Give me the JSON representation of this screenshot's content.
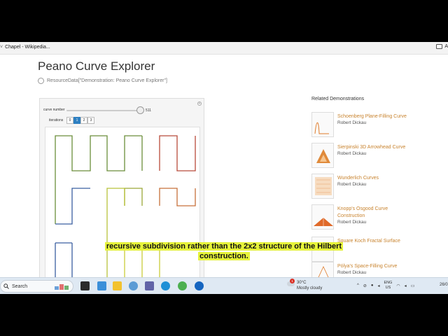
{
  "browser": {
    "bookmark_left": "Chapel - Wikipedia...",
    "bookmark_right": "A"
  },
  "page": {
    "title": "Peano Curve Explorer",
    "resource": "ResourceData[\"Demonstration: Peano Curve Explorer\"]"
  },
  "controls": {
    "curve_label": "curve number",
    "curve_value": "511",
    "curve_fraction": 0.95,
    "iterations_label": "iterations",
    "iterations": [
      "0",
      "1",
      "2",
      "3"
    ],
    "iterations_selected": "1"
  },
  "related": {
    "title": "Related Demonstrations",
    "items": [
      {
        "name": "Schoenberg Plane-Filling Curve",
        "author": "Robert Dickau"
      },
      {
        "name": "Sierpinski 3D Arrowhead Curve",
        "author": "Robert Dickau"
      },
      {
        "name": "Wunderlich Curves",
        "author": "Robert Dickau"
      },
      {
        "name": "Knopp's Osgood Curve Construction",
        "author": "Robert Dickau"
      },
      {
        "name": "Square Koch Fractal Surface",
        "author": ""
      },
      {
        "name": "Pólya's Space-Filling Curve",
        "author": "Robert Dickau"
      }
    ]
  },
  "caption": {
    "line1": "recursive subdivision rather than the 2x2 structure of the Hilbert",
    "line2": "construction."
  },
  "taskbar": {
    "search_placeholder": "Search",
    "weather_temp": "30°C",
    "weather_desc": "Mostly cloudy",
    "weather_badge": "1",
    "lang_top": "ENG",
    "lang_bottom": "US",
    "clock": "26/0"
  },
  "colors": {
    "accent": "#2d7fc1",
    "related_link": "#c8832e",
    "caption_highlight": "#e6f33a"
  }
}
